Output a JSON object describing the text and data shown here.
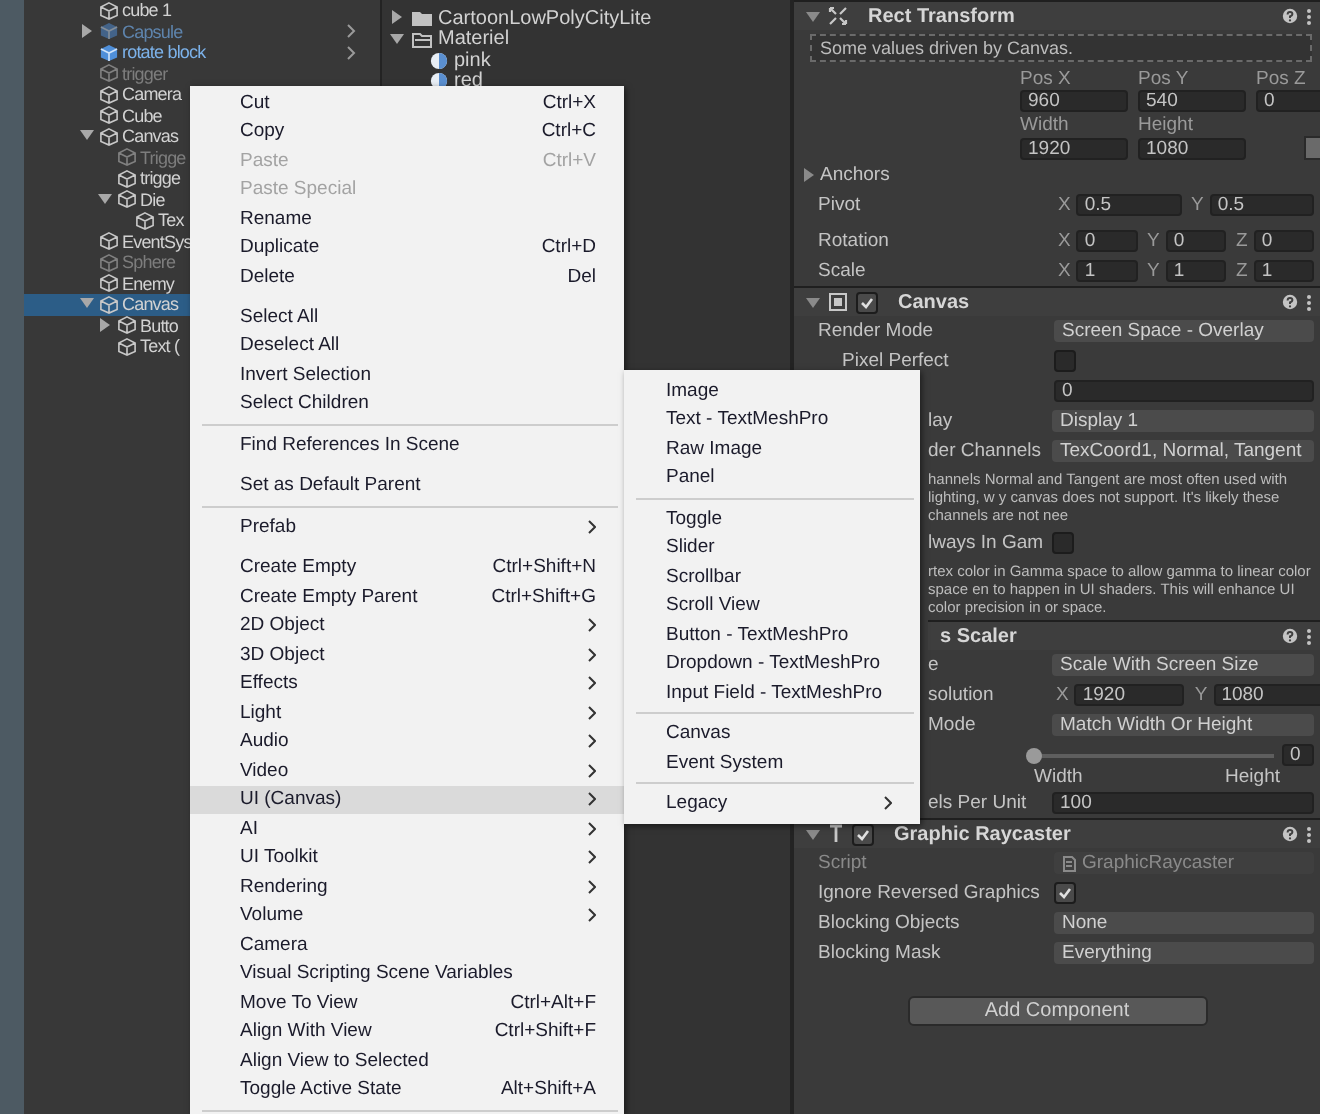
{
  "hierarchy": {
    "items": [
      {
        "label": "cube 1",
        "kind": "object",
        "inactive": false,
        "selected": false
      },
      {
        "label": "Capsule",
        "kind": "prefab",
        "inactive": true,
        "selected": false,
        "expanded": false
      },
      {
        "label": "rotate block",
        "kind": "prefab",
        "inactive": false,
        "selected": false
      },
      {
        "label": "trigger",
        "kind": "object",
        "inactive": true,
        "selected": false
      },
      {
        "label": "Camera",
        "kind": "object",
        "inactive": false,
        "selected": false
      },
      {
        "label": "Cube",
        "kind": "object",
        "inactive": false,
        "selected": false
      },
      {
        "label": "Canvas",
        "kind": "object",
        "inactive": false,
        "selected": false,
        "expanded": true,
        "children": [
          {
            "label": "Trigge",
            "kind": "object",
            "inactive": true,
            "selected": false
          },
          {
            "label": "trigge",
            "kind": "object",
            "inactive": false,
            "selected": false
          },
          {
            "label": "Die",
            "kind": "object",
            "inactive": false,
            "selected": false,
            "expanded": true,
            "children": [
              {
                "label": "Tex",
                "kind": "object",
                "inactive": false,
                "selected": false
              }
            ]
          }
        ]
      },
      {
        "label": "EventSys",
        "kind": "object",
        "inactive": false,
        "selected": false
      },
      {
        "label": "Sphere",
        "kind": "object",
        "inactive": true,
        "selected": false
      },
      {
        "label": "Enemy",
        "kind": "object",
        "inactive": false,
        "selected": false
      },
      {
        "label": "Canvas",
        "kind": "object",
        "inactive": false,
        "selected": true,
        "expanded": true,
        "children": [
          {
            "label": "Butto",
            "kind": "object",
            "inactive": false,
            "selected": false,
            "expanded": false
          },
          {
            "label": "Text (",
            "kind": "object",
            "inactive": false,
            "selected": false
          }
        ]
      }
    ]
  },
  "project": {
    "items": [
      {
        "label": "CartoonLowPolyCityLite",
        "kind": "folder",
        "expanded": false
      },
      {
        "label": "Materiel",
        "kind": "folder",
        "expanded": true,
        "children": [
          {
            "label": "pink",
            "kind": "material"
          },
          {
            "label": "red",
            "kind": "material"
          }
        ]
      }
    ]
  },
  "inspector": {
    "components": [
      {
        "kind": "rect_transform",
        "title": "Rect Transform",
        "expanded": true,
        "note": "Some values driven by Canvas.",
        "fields": [
          {
            "label": "Pos X",
            "value": "960"
          },
          {
            "label": "Pos Y",
            "value": "540"
          },
          {
            "label": "Pos Z",
            "value": "0"
          },
          {
            "label": "Width",
            "value": "1920"
          },
          {
            "label": "Height",
            "value": "1080"
          }
        ],
        "anchors": {
          "label": "Anchors",
          "expanded": false
        },
        "vectors": [
          {
            "label": "Pivot",
            "axes": [
              {
                "axis": "X",
                "value": "0.5"
              },
              {
                "axis": "Y",
                "value": "0.5"
              }
            ]
          },
          {
            "label": "Rotation",
            "axes": [
              {
                "axis": "X",
                "value": "0"
              },
              {
                "axis": "Y",
                "value": "0"
              },
              {
                "axis": "Z",
                "value": "0"
              }
            ]
          },
          {
            "label": "Scale",
            "axes": [
              {
                "axis": "X",
                "value": "1"
              },
              {
                "axis": "Y",
                "value": "1"
              },
              {
                "axis": "Z",
                "value": "1"
              }
            ]
          }
        ]
      },
      {
        "kind": "canvas",
        "title": "Canvas",
        "expanded": true,
        "enabled": true,
        "rows": [
          {
            "kind": "dropdown",
            "label": "Render Mode",
            "value": "Screen Space - Overlay",
            "children": [
              {
                "kind": "checkbox",
                "label": "Pixel Perfect",
                "checked": false
              },
              {
                "kind": "field",
                "value": "0"
              }
            ]
          },
          {
            "kind": "dropdown",
            "label": "lay",
            "value": "Display 1"
          },
          {
            "kind": "dropdown",
            "label": "der Channels",
            "value": "TexCoord1, Normal, Tangent"
          },
          {
            "kind": "note",
            "text": "hannels Normal and Tangent are most often used with lighting, w y canvas does not support. It's likely these channels are not nee"
          },
          {
            "kind": "checkbox",
            "label": "lways In Gam",
            "checked": false
          },
          {
            "kind": "note",
            "text": "rtex color in Gamma space to allow gamma to linear color space en to happen in UI shaders. This will enhance UI color precision in or space."
          }
        ]
      },
      {
        "kind": "canvas_scaler",
        "title": "s Scaler",
        "rows": [
          {
            "kind": "dropdown",
            "label": "e",
            "value": "Scale With Screen Size"
          },
          {
            "kind": "vector2",
            "label": "solution",
            "axes": [
              {
                "axis": "X",
                "value": "1920"
              },
              {
                "axis": "Y",
                "value": "1080"
              }
            ]
          },
          {
            "kind": "dropdown",
            "label": "Mode",
            "value": "Match Width Or Height"
          },
          {
            "kind": "slider",
            "level": 0,
            "reading": "0",
            "left_label": "Width",
            "right_label": "Height"
          },
          {
            "kind": "field",
            "label": "els Per Unit",
            "value": "100"
          }
        ]
      },
      {
        "kind": "graphic_raycaster",
        "title": "Graphic Raycaster",
        "expanded": true,
        "enabled": true,
        "rows": [
          {
            "kind": "script",
            "label": "Script",
            "value": "GraphicRaycaster"
          },
          {
            "kind": "checkbox",
            "label": "Ignore Reversed Graphics",
            "checked": true
          },
          {
            "kind": "dropdown",
            "label": "Blocking Objects",
            "value": "None"
          },
          {
            "kind": "dropdown",
            "label": "Blocking Mask",
            "value": "Everything"
          }
        ]
      }
    ],
    "add_component_button": "Add Component"
  },
  "context_menu": {
    "items": [
      {
        "kind": "item",
        "label": "Cut",
        "shortcut": "Ctrl+X",
        "disabled": false,
        "selected": false
      },
      {
        "kind": "item",
        "label": "Copy",
        "shortcut": "Ctrl+C",
        "disabled": false,
        "selected": false
      },
      {
        "kind": "item",
        "label": "Paste",
        "shortcut": "Ctrl+V",
        "disabled": true,
        "selected": false
      },
      {
        "kind": "item",
        "label": "Paste Special",
        "disabled": true,
        "selected": false
      },
      {
        "kind": "item",
        "label": "Rename",
        "disabled": false,
        "selected": false
      },
      {
        "kind": "item",
        "label": "Duplicate",
        "shortcut": "Ctrl+D",
        "disabled": false,
        "selected": false
      },
      {
        "kind": "item",
        "label": "Delete",
        "shortcut": "Del",
        "disabled": false,
        "selected": false
      },
      {
        "kind": "gap"
      },
      {
        "kind": "item",
        "label": "Select All",
        "disabled": false,
        "selected": false
      },
      {
        "kind": "item",
        "label": "Deselect All",
        "disabled": false,
        "selected": false
      },
      {
        "kind": "item",
        "label": "Invert Selection",
        "disabled": false,
        "selected": false
      },
      {
        "kind": "item",
        "label": "Select Children",
        "disabled": false,
        "selected": false
      },
      {
        "kind": "separator"
      },
      {
        "kind": "item",
        "label": "Find References In Scene",
        "disabled": false,
        "selected": false
      },
      {
        "kind": "gap"
      },
      {
        "kind": "item",
        "label": "Set as Default Parent",
        "disabled": false,
        "selected": false
      },
      {
        "kind": "separator"
      },
      {
        "kind": "item",
        "label": "Prefab",
        "submenu": true,
        "disabled": false,
        "selected": false
      },
      {
        "kind": "gap"
      },
      {
        "kind": "item",
        "label": "Create Empty",
        "shortcut": "Ctrl+Shift+N",
        "disabled": false,
        "selected": false
      },
      {
        "kind": "item",
        "label": "Create Empty Parent",
        "shortcut": "Ctrl+Shift+G",
        "disabled": false,
        "selected": false
      },
      {
        "kind": "item",
        "label": "2D Object",
        "submenu": true,
        "disabled": false,
        "selected": false
      },
      {
        "kind": "item",
        "label": "3D Object",
        "submenu": true,
        "disabled": false,
        "selected": false
      },
      {
        "kind": "item",
        "label": "Effects",
        "submenu": true,
        "disabled": false,
        "selected": false
      },
      {
        "kind": "item",
        "label": "Light",
        "submenu": true,
        "disabled": false,
        "selected": false
      },
      {
        "kind": "item",
        "label": "Audio",
        "submenu": true,
        "disabled": false,
        "selected": false
      },
      {
        "kind": "item",
        "label": "Video",
        "submenu": true,
        "disabled": false,
        "selected": false
      },
      {
        "kind": "item",
        "label": "UI (Canvas)",
        "submenu": true,
        "disabled": false,
        "selected": true
      },
      {
        "kind": "item",
        "label": "AI",
        "submenu": true,
        "disabled": false,
        "selected": false
      },
      {
        "kind": "item",
        "label": "UI Toolkit",
        "submenu": true,
        "disabled": false,
        "selected": false
      },
      {
        "kind": "item",
        "label": "Rendering",
        "submenu": true,
        "disabled": false,
        "selected": false
      },
      {
        "kind": "item",
        "label": "Volume",
        "submenu": true,
        "disabled": false,
        "selected": false
      },
      {
        "kind": "item",
        "label": "Camera",
        "disabled": false,
        "selected": false
      },
      {
        "kind": "item",
        "label": "Visual Scripting Scene Variables",
        "disabled": false,
        "selected": false
      },
      {
        "kind": "item",
        "label": "Move To View",
        "shortcut": "Ctrl+Alt+F",
        "disabled": false,
        "selected": false
      },
      {
        "kind": "item",
        "label": "Align With View",
        "shortcut": "Ctrl+Shift+F",
        "disabled": false,
        "selected": false
      },
      {
        "kind": "item",
        "label": "Align View to Selected",
        "disabled": false,
        "selected": false
      },
      {
        "kind": "item",
        "label": "Toggle Active State",
        "shortcut": "Alt+Shift+A",
        "disabled": false,
        "selected": false
      },
      {
        "kind": "separator"
      }
    ]
  },
  "submenu": {
    "items": [
      {
        "kind": "item",
        "label": "Image",
        "disabled": false,
        "selected": false
      },
      {
        "kind": "item",
        "label": "Text - TextMeshPro",
        "disabled": false,
        "selected": false
      },
      {
        "kind": "item",
        "label": "Raw Image",
        "disabled": false,
        "selected": false
      },
      {
        "kind": "item",
        "label": "Panel",
        "disabled": false,
        "selected": false
      },
      {
        "kind": "separator"
      },
      {
        "kind": "item",
        "label": "Toggle",
        "disabled": false,
        "selected": false
      },
      {
        "kind": "item",
        "label": "Slider",
        "disabled": false,
        "selected": false
      },
      {
        "kind": "item",
        "label": "Scrollbar",
        "disabled": false,
        "selected": false
      },
      {
        "kind": "item",
        "label": "Scroll View",
        "disabled": false,
        "selected": false
      },
      {
        "kind": "item",
        "label": "Button - TextMeshPro",
        "disabled": false,
        "selected": false
      },
      {
        "kind": "item",
        "label": "Dropdown - TextMeshPro",
        "disabled": false,
        "selected": false
      },
      {
        "kind": "item",
        "label": "Input Field - TextMeshPro",
        "disabled": false,
        "selected": false
      },
      {
        "kind": "separator"
      },
      {
        "kind": "item",
        "label": "Canvas",
        "disabled": false,
        "selected": false
      },
      {
        "kind": "item",
        "label": "Event System",
        "disabled": false,
        "selected": false
      },
      {
        "kind": "separator"
      },
      {
        "kind": "item",
        "label": "Legacy",
        "submenu": true,
        "disabled": false,
        "selected": false
      }
    ]
  }
}
